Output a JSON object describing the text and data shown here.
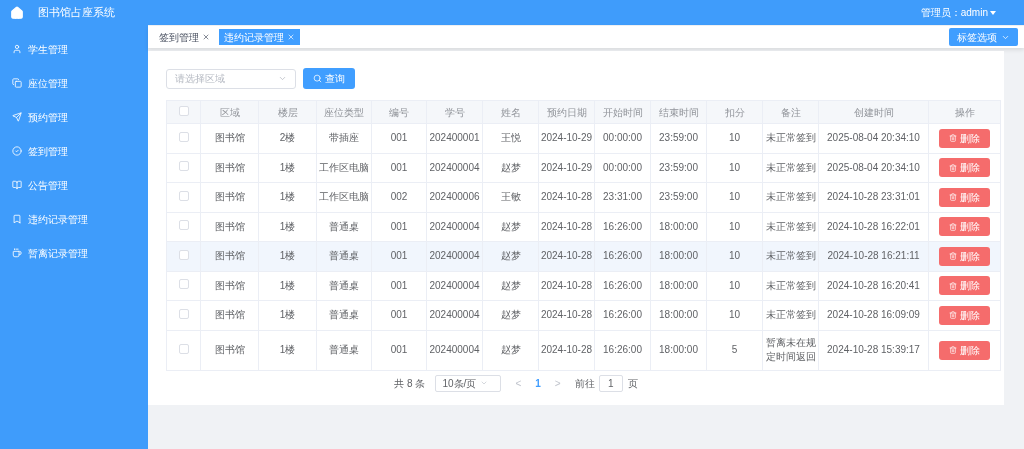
{
  "header": {
    "title": "图书馆占座系统",
    "user": "管理员：admin"
  },
  "sidebar": {
    "items": [
      {
        "label": "学生管理"
      },
      {
        "label": "座位管理"
      },
      {
        "label": "预约管理"
      },
      {
        "label": "签到管理"
      },
      {
        "label": "公告管理"
      },
      {
        "label": "违约记录管理"
      },
      {
        "label": "暂离记录管理"
      }
    ]
  },
  "tabs": [
    {
      "label": "签到管理",
      "selected": false
    },
    {
      "label": "违约记录管理",
      "selected": true
    }
  ],
  "tab_options": "标签选项",
  "filter": {
    "placeholder": "请选择区域",
    "button": "查询"
  },
  "table": {
    "all_checked": false,
    "columns": [
      "区域",
      "楼层",
      "座位类型",
      "编号",
      "学号",
      "姓名",
      "预约日期",
      "开始时间",
      "结束时间",
      "扣分",
      "备注",
      "创建时间",
      "操作"
    ],
    "rows": [
      {
        "checked": false,
        "highlighted": false,
        "cells": [
          "图书馆",
          "2楼",
          "带插座",
          "001",
          "202400001",
          "王悦",
          "2024-10-29",
          "00:00:00",
          "23:59:00",
          "10",
          "未正常签到",
          "2025-08-04 20:34:10"
        ],
        "action": "删除"
      },
      {
        "checked": false,
        "highlighted": false,
        "cells": [
          "图书馆",
          "1楼",
          "工作区电脑",
          "001",
          "202400004",
          "赵梦",
          "2024-10-29",
          "00:00:00",
          "23:59:00",
          "10",
          "未正常签到",
          "2025-08-04 20:34:10"
        ],
        "action": "删除"
      },
      {
        "checked": false,
        "highlighted": false,
        "cells": [
          "图书馆",
          "1楼",
          "工作区电脑",
          "002",
          "202400006",
          "王敏",
          "2024-10-28",
          "23:31:00",
          "23:59:00",
          "10",
          "未正常签到",
          "2024-10-28 23:31:01"
        ],
        "action": "删除"
      },
      {
        "checked": false,
        "highlighted": false,
        "cells": [
          "图书馆",
          "1楼",
          "普通桌",
          "001",
          "202400004",
          "赵梦",
          "2024-10-28",
          "16:26:00",
          "18:00:00",
          "10",
          "未正常签到",
          "2024-10-28 16:22:01"
        ],
        "action": "删除"
      },
      {
        "checked": false,
        "highlighted": true,
        "cells": [
          "图书馆",
          "1楼",
          "普通桌",
          "001",
          "202400004",
          "赵梦",
          "2024-10-28",
          "16:26:00",
          "18:00:00",
          "10",
          "未正常签到",
          "2024-10-28 16:21:11"
        ],
        "action": "删除"
      },
      {
        "checked": false,
        "highlighted": false,
        "cells": [
          "图书馆",
          "1楼",
          "普通桌",
          "001",
          "202400004",
          "赵梦",
          "2024-10-28",
          "16:26:00",
          "18:00:00",
          "10",
          "未正常签到",
          "2024-10-28 16:20:41"
        ],
        "action": "删除"
      },
      {
        "checked": false,
        "highlighted": false,
        "cells": [
          "图书馆",
          "1楼",
          "普通桌",
          "001",
          "202400004",
          "赵梦",
          "2024-10-28",
          "16:26:00",
          "18:00:00",
          "10",
          "未正常签到",
          "2024-10-28 16:09:09"
        ],
        "action": "删除"
      },
      {
        "checked": false,
        "highlighted": false,
        "cells": [
          "图书馆",
          "1楼",
          "普通桌",
          "001",
          "202400004",
          "赵梦",
          "2024-10-28",
          "16:26:00",
          "18:00:00",
          "5",
          "暂离未在规定时间返回",
          "2024-10-28 15:39:17"
        ],
        "action": "删除"
      }
    ]
  },
  "pagination": {
    "total": "共 8 条",
    "page_size": "10条/页",
    "prev": "<",
    "pages": [
      {
        "label": "1",
        "selected": true
      }
    ],
    "next": ">",
    "goto_label": "前往",
    "goto_value": "1",
    "page_unit": "页"
  }
}
